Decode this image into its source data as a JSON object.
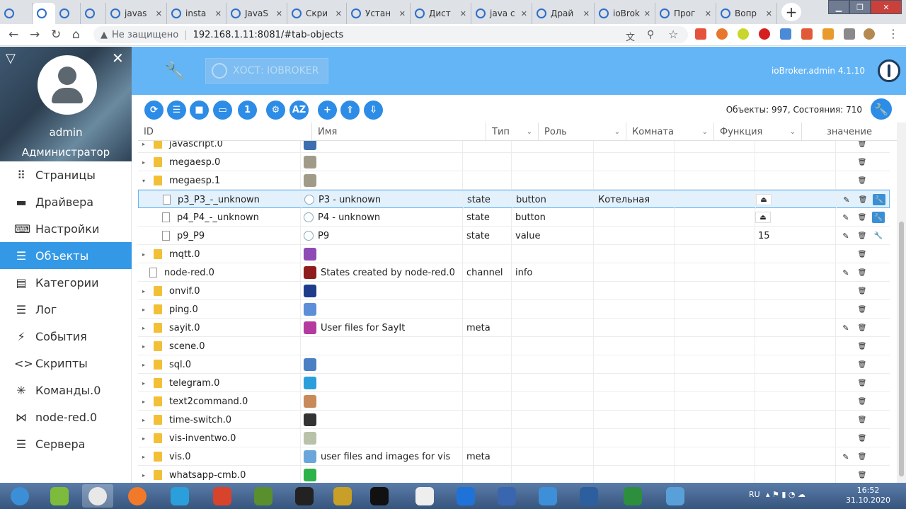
{
  "browser": {
    "tabs": [
      {
        "label": "",
        "icon": "back-icon"
      },
      {
        "label": "",
        "icon": "iobroker-icon"
      },
      {
        "label": "",
        "icon": "green-app-icon"
      },
      {
        "label": "",
        "icon": "gauge-icon"
      },
      {
        "label": "javas",
        "icon": "iobroker-icon"
      },
      {
        "label": "insta",
        "icon": "iobroker-icon"
      },
      {
        "label": "JavaS",
        "icon": "iobroker-icon"
      },
      {
        "label": "Скри",
        "icon": "iobroker-icon"
      },
      {
        "label": "Устан",
        "icon": "video-icon"
      },
      {
        "label": "Дист",
        "icon": "image-icon"
      },
      {
        "label": "java c",
        "icon": "google-icon"
      },
      {
        "label": "Драй",
        "icon": "iobroker-icon"
      },
      {
        "label": "ioBrok",
        "icon": "github-icon"
      },
      {
        "label": "Прог",
        "icon": "app-icon"
      },
      {
        "label": "Вопр",
        "icon": "iobroker-icon"
      }
    ],
    "new_tab": "+",
    "security_label": "Не защищено",
    "url": "192.168.1.11:8081/#tab-objects"
  },
  "sidebar": {
    "user_name": "admin",
    "user_role": "Администратор",
    "items": [
      {
        "label": "Страницы",
        "icon": "grid-icon"
      },
      {
        "label": "Драйвера",
        "icon": "store-icon"
      },
      {
        "label": "Настройки",
        "icon": "keyboard-icon"
      },
      {
        "label": "Объекты",
        "icon": "list-icon",
        "active": true
      },
      {
        "label": "Категории",
        "icon": "category-icon"
      },
      {
        "label": "Лог",
        "icon": "log-icon"
      },
      {
        "label": "События",
        "icon": "bolt-icon"
      },
      {
        "label": "Скрипты",
        "icon": "code-icon"
      },
      {
        "label": "Команды.0",
        "icon": "asterisk-icon"
      },
      {
        "label": "node-red.0",
        "icon": "nodes-icon"
      },
      {
        "label": "Сервера",
        "icon": "server-icon"
      }
    ]
  },
  "header": {
    "host_label": "ХОСТ: IOBROKER",
    "version": "ioBroker.admin 4.1.10"
  },
  "toolbar": {
    "counts": "Объекты: 997, Состояния: 710",
    "buttons": [
      "refresh-icon",
      "list-view-icon",
      "folder-icon",
      "folder-open-icon",
      "number-one-icon",
      "user-settings-icon",
      "sort-az-icon",
      "add-icon",
      "upload-icon",
      "download-icon"
    ],
    "button_glyphs": [
      "⟳",
      "☰",
      "■",
      "▭",
      "1",
      "⚙",
      "AZ",
      "+",
      "⇧",
      "⇩"
    ]
  },
  "table": {
    "columns": {
      "id": "ID",
      "name": "Имя",
      "type": "Тип",
      "role": "Роль",
      "room": "Комната",
      "function": "Функция",
      "value": "значение"
    },
    "rows": [
      {
        "id": "javascript.0",
        "name": "",
        "type": "",
        "role": "",
        "room": "",
        "value": "",
        "level": 0,
        "kind": "folder",
        "tri": "▸",
        "icon_color": "#3d6fb0",
        "edit": false,
        "wrench": false
      },
      {
        "id": "megaesp.0",
        "name": "",
        "type": "",
        "role": "",
        "room": "",
        "value": "",
        "level": 0,
        "kind": "folder",
        "tri": "▸",
        "icon_color": "#a09a88",
        "edit": false,
        "wrench": false
      },
      {
        "id": "megaesp.1",
        "name": "",
        "type": "",
        "role": "",
        "room": "",
        "value": "",
        "level": 0,
        "kind": "folder",
        "tri": "▾",
        "icon_color": "#a09a88",
        "edit": false,
        "wrench": false
      },
      {
        "id": "p3_P3_-_unknown",
        "name": "P3 - unknown",
        "type": "state",
        "role": "button",
        "room": "Котельная",
        "value": "⏏",
        "level": 1,
        "kind": "file",
        "tri": "",
        "icon_color": "#ffffff",
        "edit": true,
        "wrench": "blue",
        "selected": true
      },
      {
        "id": "p4_P4_-_unknown",
        "name": "P4 - unknown",
        "type": "state",
        "role": "button",
        "room": "",
        "value": "⏏",
        "level": 1,
        "kind": "file",
        "tri": "",
        "icon_color": "#ffffff",
        "edit": true,
        "wrench": "blue"
      },
      {
        "id": "p9_P9",
        "name": "P9",
        "type": "state",
        "role": "value",
        "room": "",
        "value": "15",
        "level": 1,
        "kind": "file",
        "tri": "",
        "icon_color": "#ffffff",
        "edit": true,
        "wrench": "plain"
      },
      {
        "id": "mqtt.0",
        "name": "",
        "type": "",
        "role": "",
        "room": "",
        "value": "",
        "level": 0,
        "kind": "folder",
        "tri": "▸",
        "icon_color": "#8e4ab5",
        "edit": false,
        "wrench": false
      },
      {
        "id": "node-red.0",
        "name": "States created by node-red.0",
        "type": "channel",
        "role": "info",
        "room": "",
        "value": "",
        "level": 0,
        "kind": "file",
        "tri": "",
        "icon_color": "#8f1d1d",
        "edit": true,
        "wrench": false
      },
      {
        "id": "onvif.0",
        "name": "",
        "type": "",
        "role": "",
        "room": "",
        "value": "",
        "level": 0,
        "kind": "folder",
        "tri": "▸",
        "icon_color": "#1f3c8c",
        "edit": false,
        "wrench": false
      },
      {
        "id": "ping.0",
        "name": "",
        "type": "",
        "role": "",
        "room": "",
        "value": "",
        "level": 0,
        "kind": "folder",
        "tri": "▸",
        "icon_color": "#5b8fd8",
        "edit": false,
        "wrench": false
      },
      {
        "id": "sayit.0",
        "name": "User files for SayIt",
        "type": "meta",
        "role": "",
        "room": "",
        "value": "",
        "level": 0,
        "kind": "folder",
        "tri": "▸",
        "icon_color": "#b53aa0",
        "edit": true,
        "wrench": false
      },
      {
        "id": "scene.0",
        "name": "",
        "type": "",
        "role": "",
        "room": "",
        "value": "",
        "level": 0,
        "kind": "folder",
        "tri": "▸",
        "icon_color": "",
        "edit": false,
        "wrench": false
      },
      {
        "id": "sql.0",
        "name": "",
        "type": "",
        "role": "",
        "room": "",
        "value": "",
        "level": 0,
        "kind": "folder",
        "tri": "▸",
        "icon_color": "#4a7fc4",
        "edit": false,
        "wrench": false
      },
      {
        "id": "telegram.0",
        "name": "",
        "type": "",
        "role": "",
        "room": "",
        "value": "",
        "level": 0,
        "kind": "folder",
        "tri": "▸",
        "icon_color": "#2b9fdb",
        "edit": false,
        "wrench": false
      },
      {
        "id": "text2command.0",
        "name": "",
        "type": "",
        "role": "",
        "room": "",
        "value": "",
        "level": 0,
        "kind": "folder",
        "tri": "▸",
        "icon_color": "#c98a5a",
        "edit": false,
        "wrench": false
      },
      {
        "id": "time-switch.0",
        "name": "",
        "type": "",
        "role": "",
        "room": "",
        "value": "",
        "level": 0,
        "kind": "folder",
        "tri": "▸",
        "icon_color": "#333333",
        "edit": false,
        "wrench": false
      },
      {
        "id": "vis-inventwo.0",
        "name": "",
        "type": "",
        "role": "",
        "room": "",
        "value": "",
        "level": 0,
        "kind": "folder",
        "tri": "▸",
        "icon_color": "#b9c2a8",
        "edit": false,
        "wrench": false
      },
      {
        "id": "vis.0",
        "name": "user files and images for vis",
        "type": "meta",
        "role": "",
        "room": "",
        "value": "",
        "level": 0,
        "kind": "folder",
        "tri": "▸",
        "icon_color": "#6aa6d9",
        "edit": true,
        "wrench": false
      },
      {
        "id": "whatsapp-cmb.0",
        "name": "",
        "type": "",
        "role": "",
        "room": "",
        "value": "",
        "level": 0,
        "kind": "folder",
        "tri": "▸",
        "icon_color": "#2bb34a",
        "edit": false,
        "wrench": false
      }
    ]
  },
  "taskbar": {
    "lang": "RU",
    "time": "16:52",
    "date": "31.10.2020",
    "apps": [
      "start-button",
      "minecraft-icon",
      "chrome-icon",
      "firefox-icon",
      "telegram-icon",
      "fruit-icon",
      "grass-block-icon",
      "pubg-icon",
      "rockstar-icon",
      "epic-games-icon",
      "document-icon",
      "vpn-icon",
      "network-icon",
      "phone-icon",
      "download-icon",
      "torrent-icon",
      "tools-icon"
    ]
  },
  "colors": {
    "accent": "#3399e6",
    "header": "#64b5f6",
    "button": "#2c8ce6",
    "folder": "#f2c037"
  }
}
